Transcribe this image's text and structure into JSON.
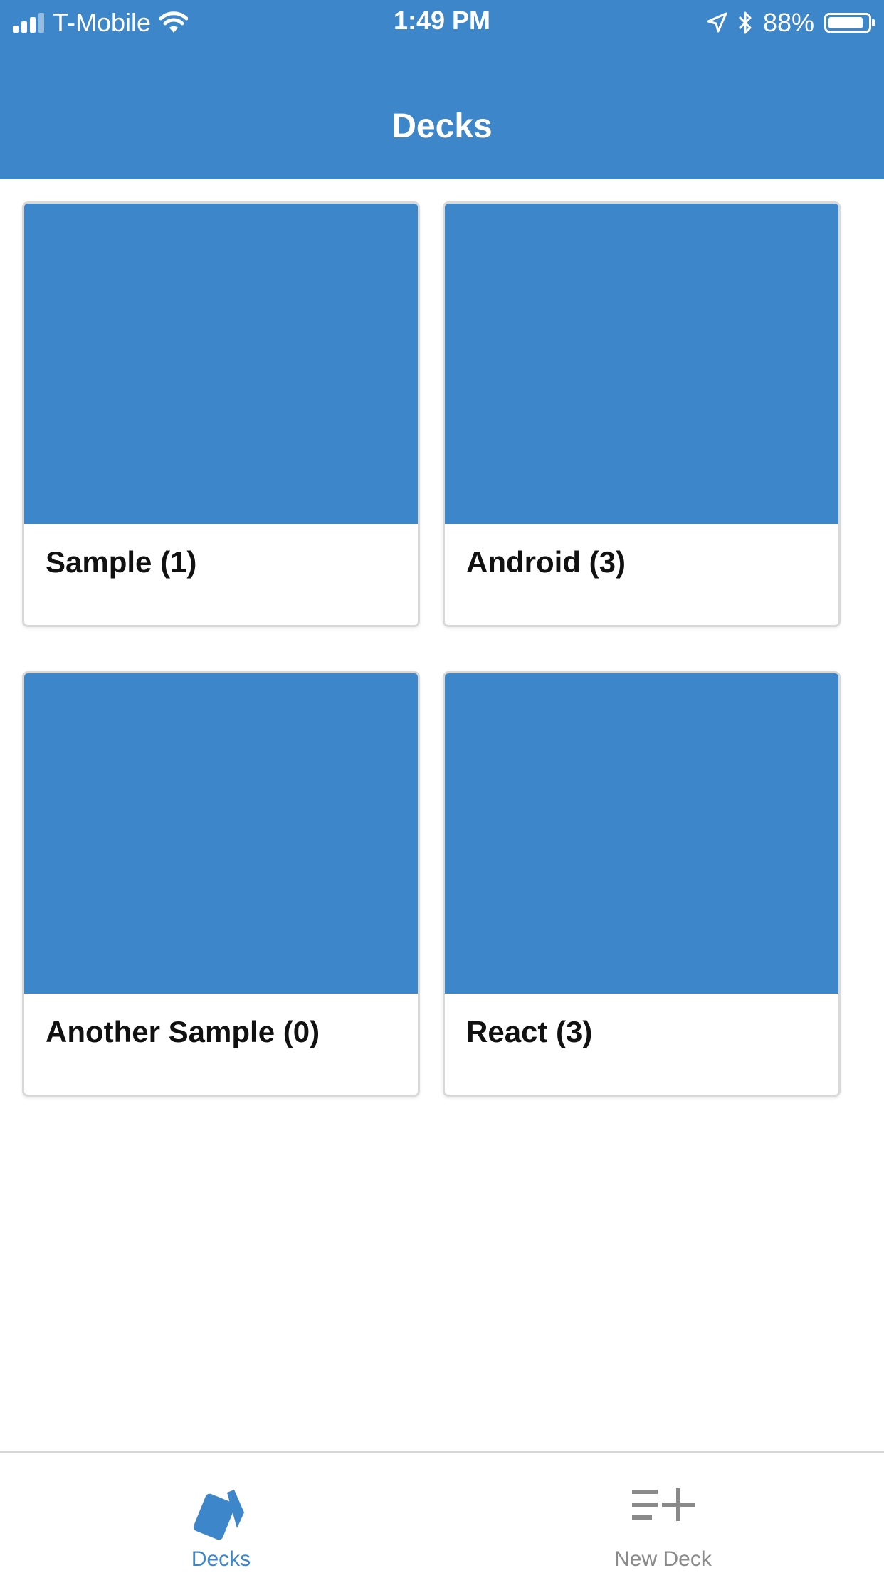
{
  "colors": {
    "accent": "#3d86c9",
    "tab_inactive": "#8a8a8a",
    "card_border": "#d9d9d9"
  },
  "status_bar": {
    "carrier": "T-Mobile",
    "time": "1:49 PM",
    "battery": "88%",
    "battery_level": 0.88,
    "signal_bars_active": 3,
    "signal_bars_total": 4
  },
  "header": {
    "title": "Decks"
  },
  "decks": [
    {
      "label": "Sample (1)"
    },
    {
      "label": "Android (3)"
    },
    {
      "label": "Another Sample (0)"
    },
    {
      "label": "React (3)"
    }
  ],
  "tabbar": {
    "tabs": [
      {
        "label": "Decks",
        "icon": "cards-icon",
        "active": true
      },
      {
        "label": "New Deck",
        "icon": "playlist-add-icon",
        "active": false
      }
    ]
  }
}
